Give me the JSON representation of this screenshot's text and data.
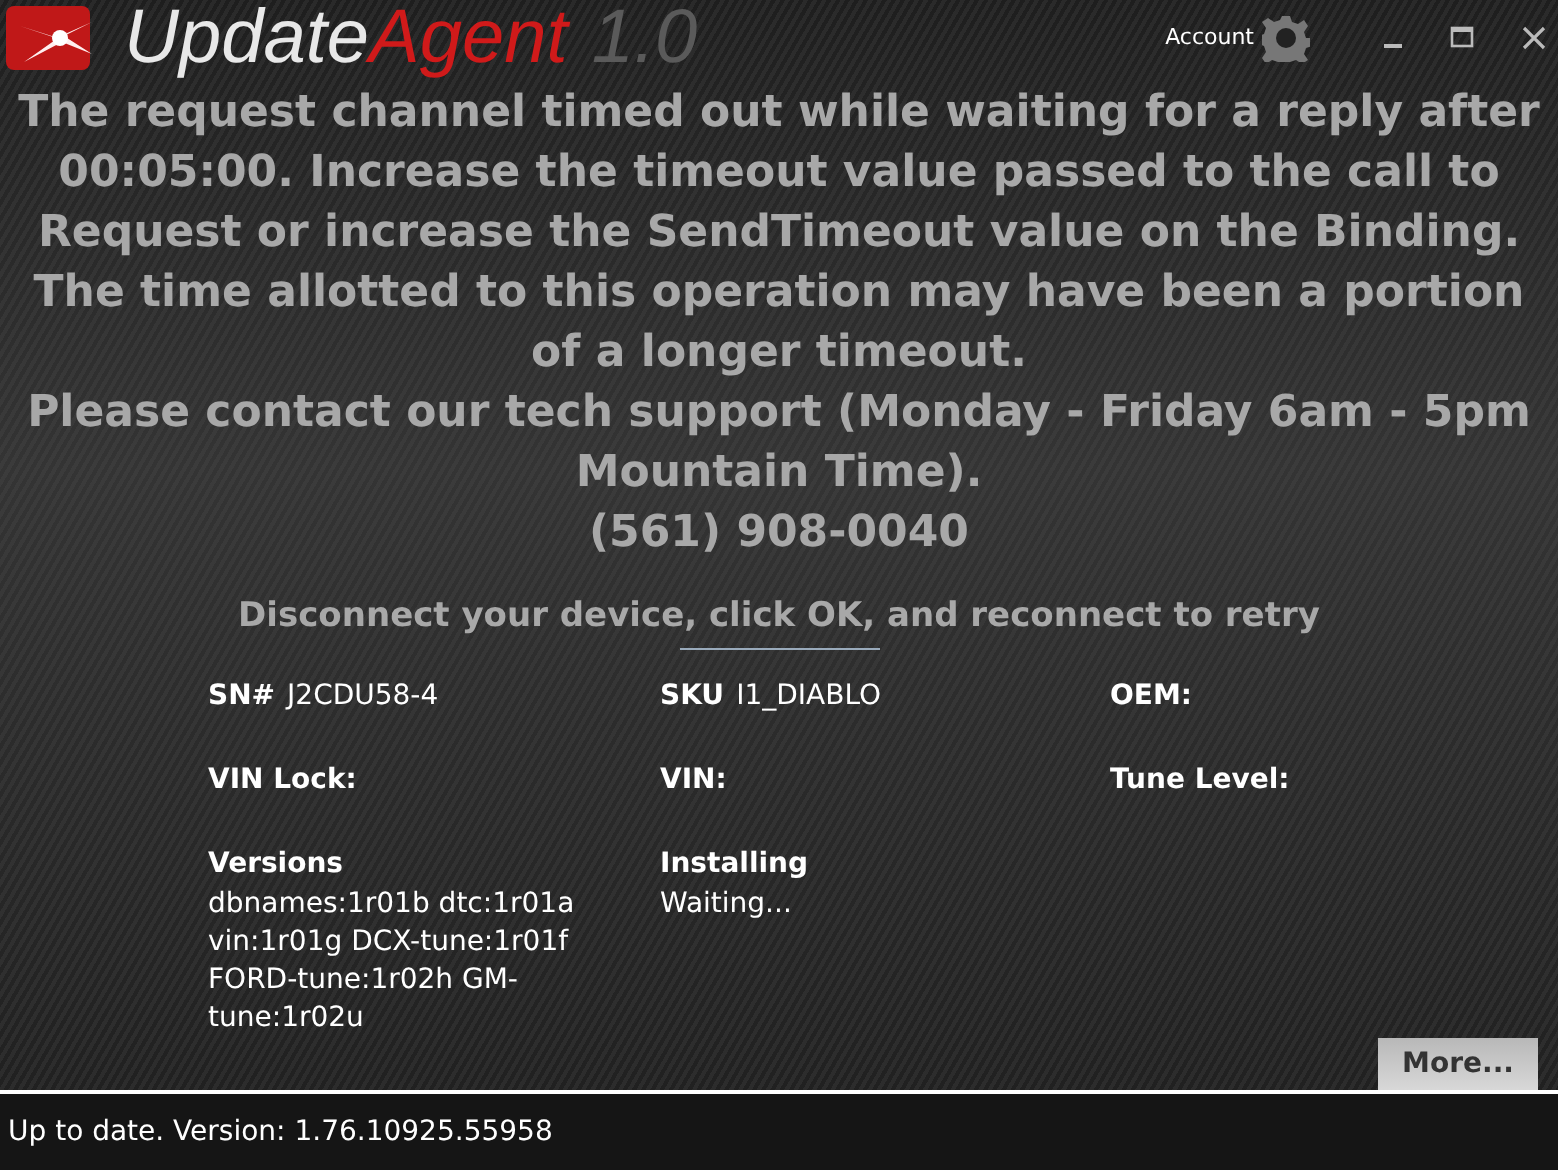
{
  "window": {
    "logo": {
      "part_1": "Update",
      "part_2": "Agent",
      "part_3": "1.0"
    },
    "account": "Account"
  },
  "message": [
    "The request channel timed out while waiting for a reply after 00:05:00. Increase the timeout value passed to the call to Request or increase the SendTimeout value on the Binding. The time allotted to this operation may have been a portion of a longer timeout.",
    "Please contact our tech support (Monday - Friday 6am - 5pm Mountain Time).",
    "(561) 908-0040"
  ],
  "instruction": "Disconnect your device, click OK, and reconnect to retry",
  "fields": [
    {
      "label": "SN#",
      "value": "J2CDU58-4",
      "kind": "inline"
    },
    {
      "label": "SKU",
      "value": "I1_DIABLO",
      "kind": "inline"
    },
    {
      "label": "OEM:",
      "kind": "inline"
    },
    {
      "label": "VIN Lock:",
      "kind": "inline"
    },
    {
      "label": "VIN:",
      "kind": "inline"
    },
    {
      "label": "Tune Level:",
      "kind": "inline"
    },
    {
      "label": "Versions",
      "value": "dbnames:1r01b dtc:1r01a vin:1r01g DCX-tune:1r01f FORD-tune:1r02h GM-tune:1r02u",
      "kind": "block"
    },
    {
      "label": "Installing",
      "value": "Waiting...",
      "kind": "block"
    }
  ],
  "more_button": "More...",
  "status_bar": "Up to date. Version: 1.76.10925.55958"
}
